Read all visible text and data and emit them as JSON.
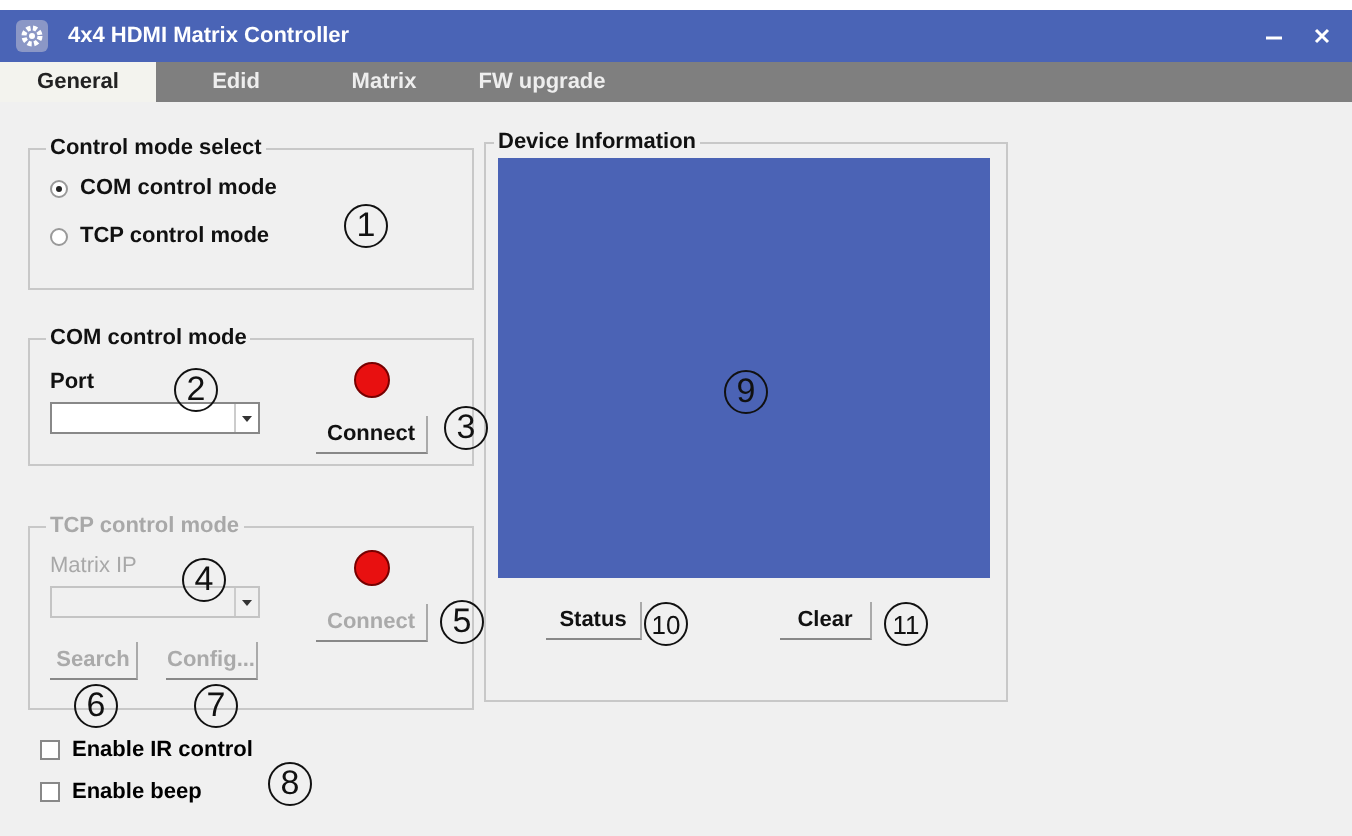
{
  "window": {
    "title": "4x4 HDMI Matrix Controller"
  },
  "tabs": [
    {
      "label": "General",
      "selected": true
    },
    {
      "label": "Edid",
      "selected": false
    },
    {
      "label": "Matrix",
      "selected": false
    },
    {
      "label": "FW upgrade",
      "selected": false
    }
  ],
  "control_mode_select": {
    "title": "Control mode select",
    "options": [
      {
        "label": "COM control mode",
        "selected": true
      },
      {
        "label": "TCP control mode",
        "selected": false
      }
    ]
  },
  "com_control_mode": {
    "title": "COM control mode",
    "disabled": false,
    "port_label": "Port",
    "connected": false,
    "connect_button": "Connect"
  },
  "tcp_control_mode": {
    "title": "TCP control mode",
    "disabled": true,
    "ip_label": "Matrix  IP",
    "connected": false,
    "connect_button": "Connect",
    "search_button": "Search",
    "config_button": "Config..."
  },
  "checkboxes": [
    {
      "label": "Enable IR control",
      "checked": false
    },
    {
      "label": "Enable beep",
      "checked": false
    }
  ],
  "device_information": {
    "title": "Device Information",
    "status_button": "Status",
    "clear_button": "Clear"
  },
  "callouts": [
    "1",
    "2",
    "3",
    "4",
    "5",
    "6",
    "7",
    "8",
    "9",
    "10",
    "11"
  ]
}
